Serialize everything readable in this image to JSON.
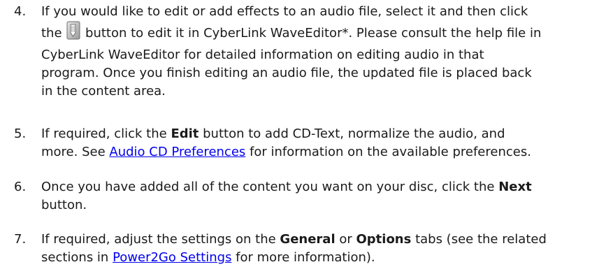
{
  "steps": [
    {
      "number": "4.",
      "line1": "If you would like to edit or add effects to an audio file, select it and then click",
      "line2_pre": "the",
      "line2_icon": "edit-audio-icon",
      "line2_post": "button to edit it in CyberLink WaveEditor*. Please consult the help file in",
      "line3": "CyberLink WaveEditor for detailed information on editing audio in that",
      "line4": "program. Once you finish editing an audio file, the updated file is placed back",
      "line5": "in the content area."
    },
    {
      "number": "5.",
      "a": "If required, click the ",
      "b": "Edit",
      "c": " button to add CD-Text, normalize the audio, and",
      "d": "more. See ",
      "link": "Audio CD Preferences",
      "e": " for information on the available preferences."
    },
    {
      "number": "6.",
      "a": "Once you have added all of the content you want on your disc, click the ",
      "b": "Next",
      "c": "button."
    },
    {
      "number": "7.",
      "a": "If required, adjust the settings on the ",
      "b": "General",
      "c": " or ",
      "d": "Options",
      "e": " tabs (see the related",
      "f": "sections in ",
      "link": "Power2Go Settings",
      "g": " for more information)."
    }
  ],
  "colors": {
    "text": "#1a1a1a",
    "link": "#0000ee"
  }
}
